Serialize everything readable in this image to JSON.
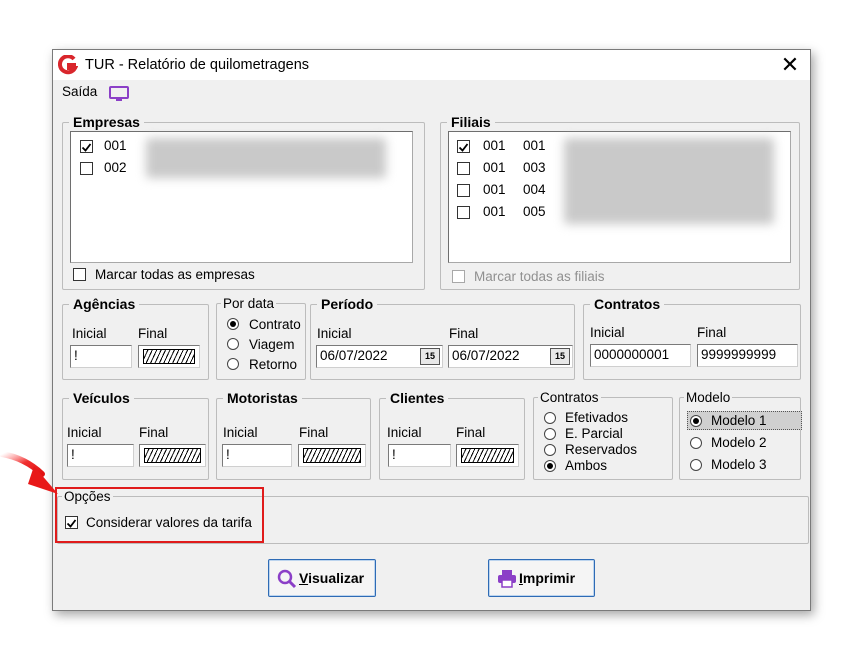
{
  "window": {
    "title": "TUR - Relatório de quilometragens",
    "close_glyph": "✕"
  },
  "menu": {
    "saida": "Saída"
  },
  "empresas": {
    "legend": "Empresas",
    "items": [
      {
        "code": "001",
        "checked": true
      },
      {
        "code": "002",
        "checked": false
      }
    ],
    "mark_all": "Marcar todas as empresas"
  },
  "filiais": {
    "legend": "Filiais",
    "items": [
      {
        "code1": "001",
        "code2": "001",
        "checked": true
      },
      {
        "code1": "001",
        "code2": "003",
        "checked": false
      },
      {
        "code1": "001",
        "code2": "004",
        "checked": false
      },
      {
        "code1": "001",
        "code2": "005",
        "checked": false
      }
    ],
    "mark_all": "Marcar todas as filiais"
  },
  "agencias": {
    "legend": "Agências",
    "inicial_label": "Inicial",
    "final_label": "Final",
    "inicial_value": "!"
  },
  "por_data": {
    "legend": "Por data",
    "options": [
      "Contrato",
      "Viagem",
      "Retorno"
    ],
    "selected": "Contrato"
  },
  "periodo": {
    "legend": "Período",
    "inicial_label": "Inicial",
    "final_label": "Final",
    "inicial_value": "06/07/2022",
    "final_value": "06/07/2022",
    "cal_label": "15"
  },
  "contratos": {
    "legend": "Contratos",
    "inicial_label": "Inicial",
    "final_label": "Final",
    "inicial_value": "0000000001",
    "final_value": "9999999999"
  },
  "veiculos": {
    "legend": "Veículos",
    "inicial_label": "Inicial",
    "final_label": "Final",
    "inicial_value": "!"
  },
  "motoristas": {
    "legend": "Motoristas",
    "inicial_label": "Inicial",
    "final_label": "Final",
    "inicial_value": "!"
  },
  "clientes": {
    "legend": "Clientes",
    "inicial_label": "Inicial",
    "final_label": "Final",
    "inicial_value": "!"
  },
  "contratos_filtro": {
    "legend": "Contratos",
    "options": [
      "Efetivados",
      "E. Parcial",
      "Reservados",
      "Ambos"
    ],
    "selected": "Ambos"
  },
  "modelo": {
    "legend": "Modelo",
    "options": [
      "Modelo 1",
      "Modelo 2",
      "Modelo 3"
    ],
    "selected": "Modelo 1"
  },
  "opcoes": {
    "legend": "Opções",
    "considerar_label": "Considerar valores da tarifa",
    "considerar_checked": true
  },
  "buttons": {
    "visualizar_prefix": "V",
    "visualizar_rest": "isualizar",
    "imprimir_prefix": "I",
    "imprimir_rest": "mprimir"
  },
  "colors": {
    "accent": "#2e6bb5",
    "highlight": "#e01b1b",
    "logo": "#d9262c",
    "monitor": "#8b3fc7"
  }
}
